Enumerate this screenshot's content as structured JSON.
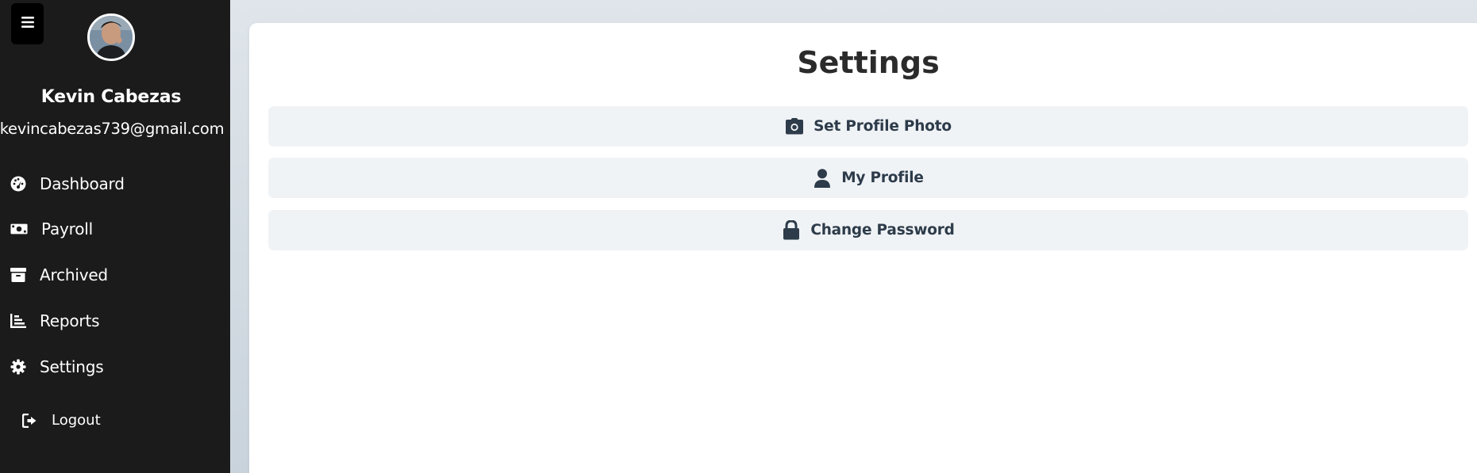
{
  "colors": {
    "sidebar_bg": "#1b1b1b",
    "page_bg": "#dfe5ea",
    "card_bg": "#ffffff",
    "button_bg": "#f0f3f6",
    "button_text": "#2d3b4a",
    "title_text": "#2b2b2b"
  },
  "sidebar": {
    "menu_icon": "hamburger-icon",
    "user": {
      "name": "Kevin Cabezas",
      "email": "kevincabezas739@gmail.com"
    },
    "items": [
      {
        "label": "Dashboard",
        "icon": "gauge-icon"
      },
      {
        "label": "Payroll",
        "icon": "money-bill-icon"
      },
      {
        "label": "Archived",
        "icon": "archive-box-icon"
      },
      {
        "label": "Reports",
        "icon": "bar-chart-icon"
      },
      {
        "label": "Settings",
        "icon": "gear-icon"
      }
    ],
    "logout": {
      "label": "Logout",
      "icon": "sign-out-icon"
    }
  },
  "main": {
    "title": "Settings",
    "options": [
      {
        "label": "Set Profile Photo",
        "icon": "camera-icon"
      },
      {
        "label": "My Profile",
        "icon": "user-icon"
      },
      {
        "label": "Change Password",
        "icon": "lock-icon"
      }
    ]
  }
}
